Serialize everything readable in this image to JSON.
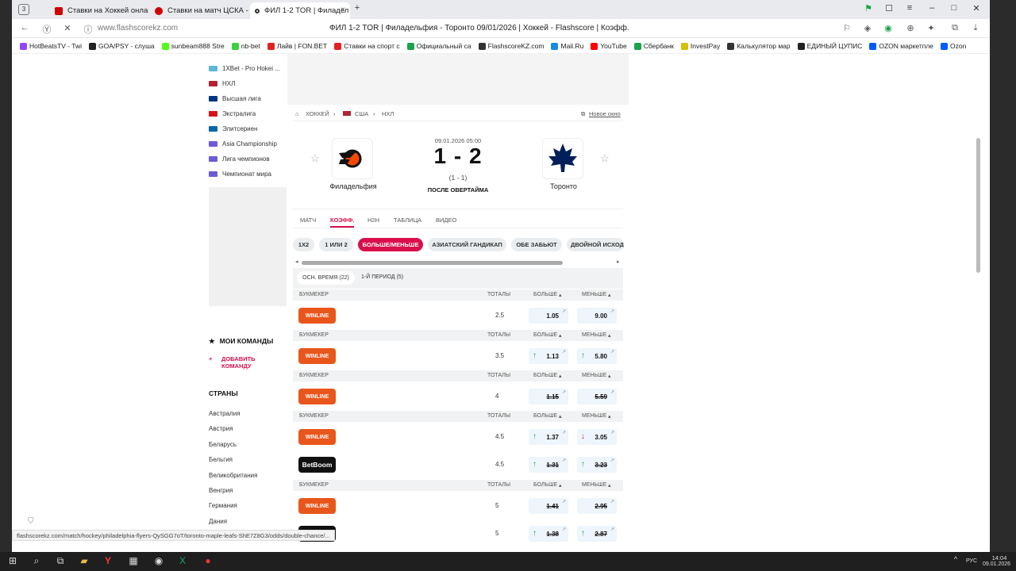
{
  "tabs": {
    "count": "3",
    "items": [
      {
        "label": "Ставки на Хоккей онлайн",
        "color": "#d00000"
      },
      {
        "label": "Ставки на матч ЦСКА - Ш",
        "color": "#d00000"
      },
      {
        "label": "ФИЛ 1-2 TOR | Филадел",
        "color": "#2a2a2a"
      }
    ],
    "close": "×",
    "new": "+"
  },
  "nav": {
    "url": "www.flashscorekz.com",
    "title": "ФИЛ 1-2 TOR | Филадельфия - Торонто 09/01/2026 | Хоккей - Flashscore | Коэфф."
  },
  "bookmarks": [
    {
      "label": "HotBeatsTV - Twi",
      "color": "#9146ff"
    },
    {
      "label": "GOA/PSY - слуша",
      "color": "#222"
    },
    {
      "label": "sunbeam888 Stre",
      "color": "#53fc18"
    },
    {
      "label": "nb-bet",
      "color": "#3bd13b"
    },
    {
      "label": "Лайв | FON.BET",
      "color": "#e42121"
    },
    {
      "label": "Ставки на спорт с",
      "color": "#e42121"
    },
    {
      "label": "Официальный са",
      "color": "#1aa34a"
    },
    {
      "label": "FlashscoreKZ.com",
      "color": "#333"
    },
    {
      "label": "Mail.Ru",
      "color": "#168de2"
    },
    {
      "label": "YouTube",
      "color": "#ff0000"
    },
    {
      "label": "Сбербанк",
      "color": "#1aa34a"
    },
    {
      "label": "InvestPay",
      "color": "#d4c000"
    },
    {
      "label": "Калькулятор мар",
      "color": "#333"
    },
    {
      "label": "ЕДИНЫЙ ЦУПИС",
      "color": "#222"
    },
    {
      "label": "OZON маркетпле",
      "color": "#005bff"
    },
    {
      "label": "Ozon",
      "color": "#005bff"
    }
  ],
  "sidebar": {
    "leagues": [
      {
        "label": "1XBet - Pro Hokei ...",
        "flag": "#5bb8d6"
      },
      {
        "label": "НХЛ",
        "flag": "#b22234"
      },
      {
        "label": "Высшая лига",
        "flag": "#003580"
      },
      {
        "label": "Экстралига",
        "flag": "#d7141a"
      },
      {
        "label": "Элитсериен",
        "flag": "#006aa7"
      },
      {
        "label": "Asia Championship",
        "flag": "#6b5bd6"
      },
      {
        "label": "Лига чемпионов",
        "flag": "#6b5bd6"
      },
      {
        "label": "Чемпионат мира",
        "flag": "#6b5bd6"
      }
    ],
    "my_teams": "МОИ КОМАНДЫ",
    "add_team": "ДОБАВИТЬ КОМАНДУ",
    "countries_title": "СТРАНЫ",
    "countries": [
      "Австралия",
      "Австрия",
      "Беларусь",
      "Бельгия",
      "Великобритания",
      "Венгрия",
      "Германия",
      "Дания"
    ]
  },
  "breadcrumb": {
    "sport": "ХОККЕЙ",
    "country": "США",
    "league": "НХЛ",
    "new_window": "Новое окно"
  },
  "match": {
    "datetime": "09.01.2026 05:00",
    "score": "1 - 2",
    "period_score": "(1 - 1)",
    "status": "ПОСЛЕ ОВЕРТАЙМА",
    "home": "Филадельфия",
    "away": "Торонто"
  },
  "match_tabs": [
    "МАТЧ",
    "КОЭФФ.",
    "H2H",
    "ТАБЛИЦА",
    "ВИДЕО"
  ],
  "market_pills": [
    "1X2",
    "1 ИЛИ 2",
    "БОЛЬШЕ/МЕНЬШЕ",
    "АЗИАТСКИЙ ГАНДИКАП",
    "ОБЕ ЗАБЬЮТ",
    "ДВОЙНОЙ ИСХОД"
  ],
  "period_tabs": [
    "ОСН. ВРЕМЯ (22)",
    "1-Й ПЕРИОД (5)"
  ],
  "table_header": {
    "bookmaker": "БУКМЕКЕР",
    "totals": "ТОТАЛЫ",
    "over": "БОЛЬШЕ",
    "under": "МЕНЬШЕ"
  },
  "odds_rows": [
    {
      "bookmaker": "WINLINE",
      "total": "2.5",
      "over": "1.05",
      "under": "9.00",
      "over_trend": "",
      "under_trend": "",
      "struck": false
    },
    {
      "bookmaker": "WINLINE",
      "total": "3.5",
      "over": "1.13",
      "under": "5.80",
      "over_trend": "up",
      "under_trend": "up",
      "struck": false
    },
    {
      "bookmaker": "WINLINE",
      "total": "4",
      "over": "1.15",
      "under": "5.59",
      "over_trend": "",
      "under_trend": "",
      "struck": true
    },
    {
      "bookmaker": "WINLINE",
      "total": "4.5",
      "over": "1.37",
      "under": "3.05",
      "over_trend": "up",
      "under_trend": "down",
      "struck": false
    },
    {
      "bookmaker": "BetBoom",
      "total": "4.5",
      "over": "1.31",
      "under": "3.23",
      "over_trend": "up",
      "under_trend": "up",
      "struck": true
    },
    {
      "bookmaker": "WINLINE",
      "total": "5",
      "over": "1.41",
      "under": "2.95",
      "over_trend": "",
      "under_trend": "",
      "struck": true
    },
    {
      "bookmaker": "BetBoom",
      "total": "5",
      "over": "1.38",
      "under": "2.87",
      "over_trend": "up",
      "under_trend": "up",
      "struck": true
    }
  ],
  "status_url": "flashscorekz.com/match/hockey/philadelphia-flyers-QySGG7oT/toronto-maple-leafs-ShE7Z8G3/odds/double-chance/...",
  "taskbar": {
    "time": "14:04",
    "date": "09.01.2026",
    "lang": "РУС"
  },
  "colors": {
    "accent": "#d90f4c",
    "winline": "#e9561b",
    "betboom": "#111111",
    "up": "#1aa34a",
    "down": "#d21f2b"
  }
}
